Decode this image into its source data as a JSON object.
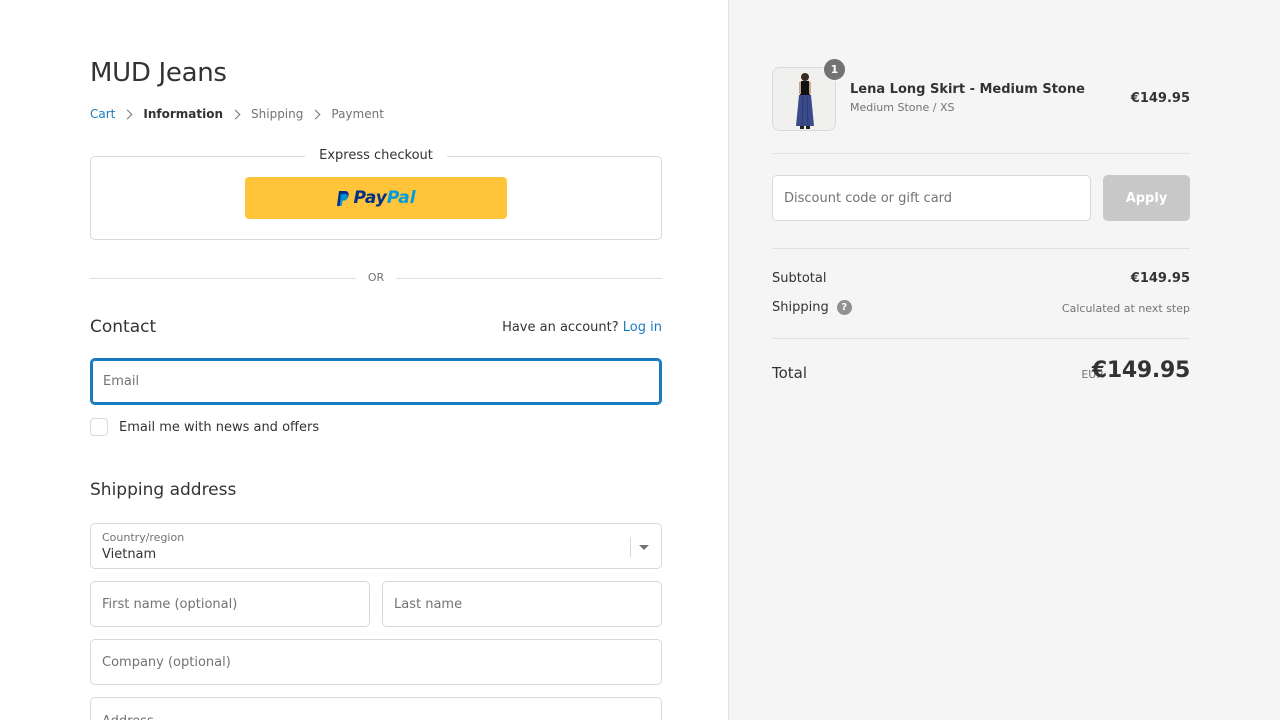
{
  "store": {
    "name": "MUD Jeans"
  },
  "breadcrumb": {
    "cart": "Cart",
    "information": "Information",
    "shipping": "Shipping",
    "payment": "Payment"
  },
  "express": {
    "title": "Express checkout",
    "paypal_pay": "Pay",
    "paypal_pal": "Pal"
  },
  "or_text": "OR",
  "contact": {
    "title": "Contact",
    "have_account": "Have an account?",
    "login": "Log in",
    "email_placeholder": "Email",
    "newsletter_label": "Email me with news and offers"
  },
  "shipping_address": {
    "title": "Shipping address",
    "country_label": "Country/region",
    "country_value": "Vietnam",
    "first_name_placeholder": "First name (optional)",
    "last_name_placeholder": "Last name",
    "company_placeholder": "Company (optional)",
    "address_placeholder": "Address"
  },
  "order": {
    "item": {
      "name": "Lena Long Skirt - Medium Stone",
      "variant": "Medium Stone / XS",
      "price": "€149.95",
      "quantity": "1"
    },
    "discount_placeholder": "Discount code or gift card",
    "apply_label": "Apply",
    "subtotal_label": "Subtotal",
    "subtotal_value": "€149.95",
    "shipping_label": "Shipping",
    "shipping_value": "Calculated at next step",
    "total_label": "Total",
    "currency": "EUR",
    "total_value": "€149.95"
  },
  "colors": {
    "accent": "#197bbd",
    "paypal_yellow": "#ffc439",
    "sidebar_bg": "#f5f5f5"
  }
}
